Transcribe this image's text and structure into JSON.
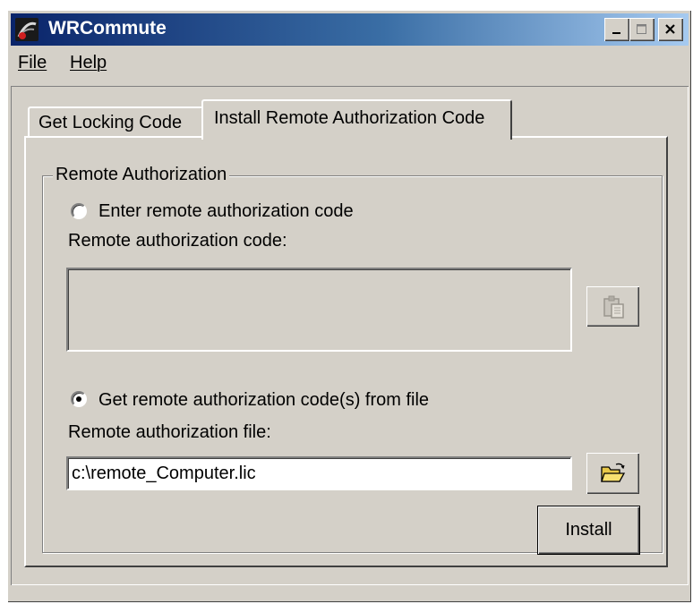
{
  "window": {
    "title": "WRCommute",
    "icon": "wrcommute-app-icon",
    "controls": [
      "minimize",
      "maximize",
      "close"
    ]
  },
  "menu": {
    "file": "File",
    "help": "Help"
  },
  "tabs": [
    {
      "label": "Get Locking Code",
      "active": false
    },
    {
      "label": "Install Remote Authorization Code",
      "active": true
    }
  ],
  "group": {
    "title": "Remote Authorization",
    "option_enter": {
      "label": "Enter remote authorization code",
      "selected": false
    },
    "code_label": "Remote authorization code:",
    "code_value": "",
    "paste_icon": "paste-clipboard-icon",
    "option_file": {
      "label": "Get remote authorization code(s) from file",
      "selected": true
    },
    "file_label": "Remote authorization file:",
    "file_value": "c:\\remote_Computer.lic",
    "browse_icon": "open-folder-icon",
    "install_label": "Install"
  }
}
